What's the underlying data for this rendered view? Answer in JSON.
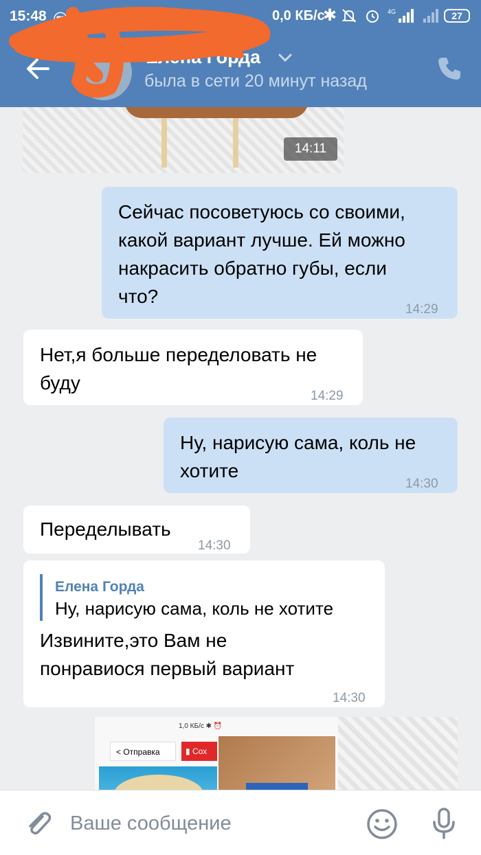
{
  "status_bar": {
    "time": "15:48",
    "app_icons_1": "ⓜ",
    "app_icons_2": "G",
    "network_speed": "0,0 КБ/с",
    "bluetooth": "✱",
    "battery": "27"
  },
  "header": {
    "contact_name": "Елена Горда",
    "contact_status": "была в сети 20 минут назад"
  },
  "colors": {
    "header_bg": "#5181b8",
    "outgoing_bubble": "#cce0f5",
    "incoming_bubble": "#ffffff",
    "chat_bg": "#edeef0",
    "scribble": "#f26a2e"
  },
  "messages": [
    {
      "direction": "in",
      "type": "photo",
      "time": "14:11"
    },
    {
      "direction": "out",
      "lines": [
        "Сейчас посоветуюсь со своими,",
        "какой вариант лучше. Ей можно",
        "накрасить обратно губы, если",
        "что?"
      ],
      "time": "14:29"
    },
    {
      "direction": "in",
      "lines": [
        "Нет,я больше переделовать не",
        "буду"
      ],
      "time": "14:29"
    },
    {
      "direction": "out",
      "lines": [
        "Ну, нарисую сама, коль не",
        "хотите"
      ],
      "time": "14:30"
    },
    {
      "direction": "in",
      "lines": [
        "Переделывать"
      ],
      "time": "14:30"
    },
    {
      "direction": "in",
      "reply_to": {
        "name": "Елена Горда",
        "text": "Ну, нарисую сама, коль не хотите"
      },
      "lines": [
        "Извините,это Вам не",
        "понравиося первый вариант"
      ],
      "time": "14:30"
    }
  ],
  "attachment_preview": {
    "mini_status": "1,0 КБ/с ✱ ⏰",
    "share_label": "Отправка",
    "red_label": "Сох"
  },
  "composer": {
    "placeholder": "Ваше сообщение"
  },
  "icons": [
    "back-arrow-icon",
    "chevron-down-icon",
    "phone-icon",
    "paperclip-icon",
    "emoji-icon",
    "microphone-icon",
    "alarm-icon",
    "mute-icon",
    "signal-icon",
    "battery-icon"
  ]
}
